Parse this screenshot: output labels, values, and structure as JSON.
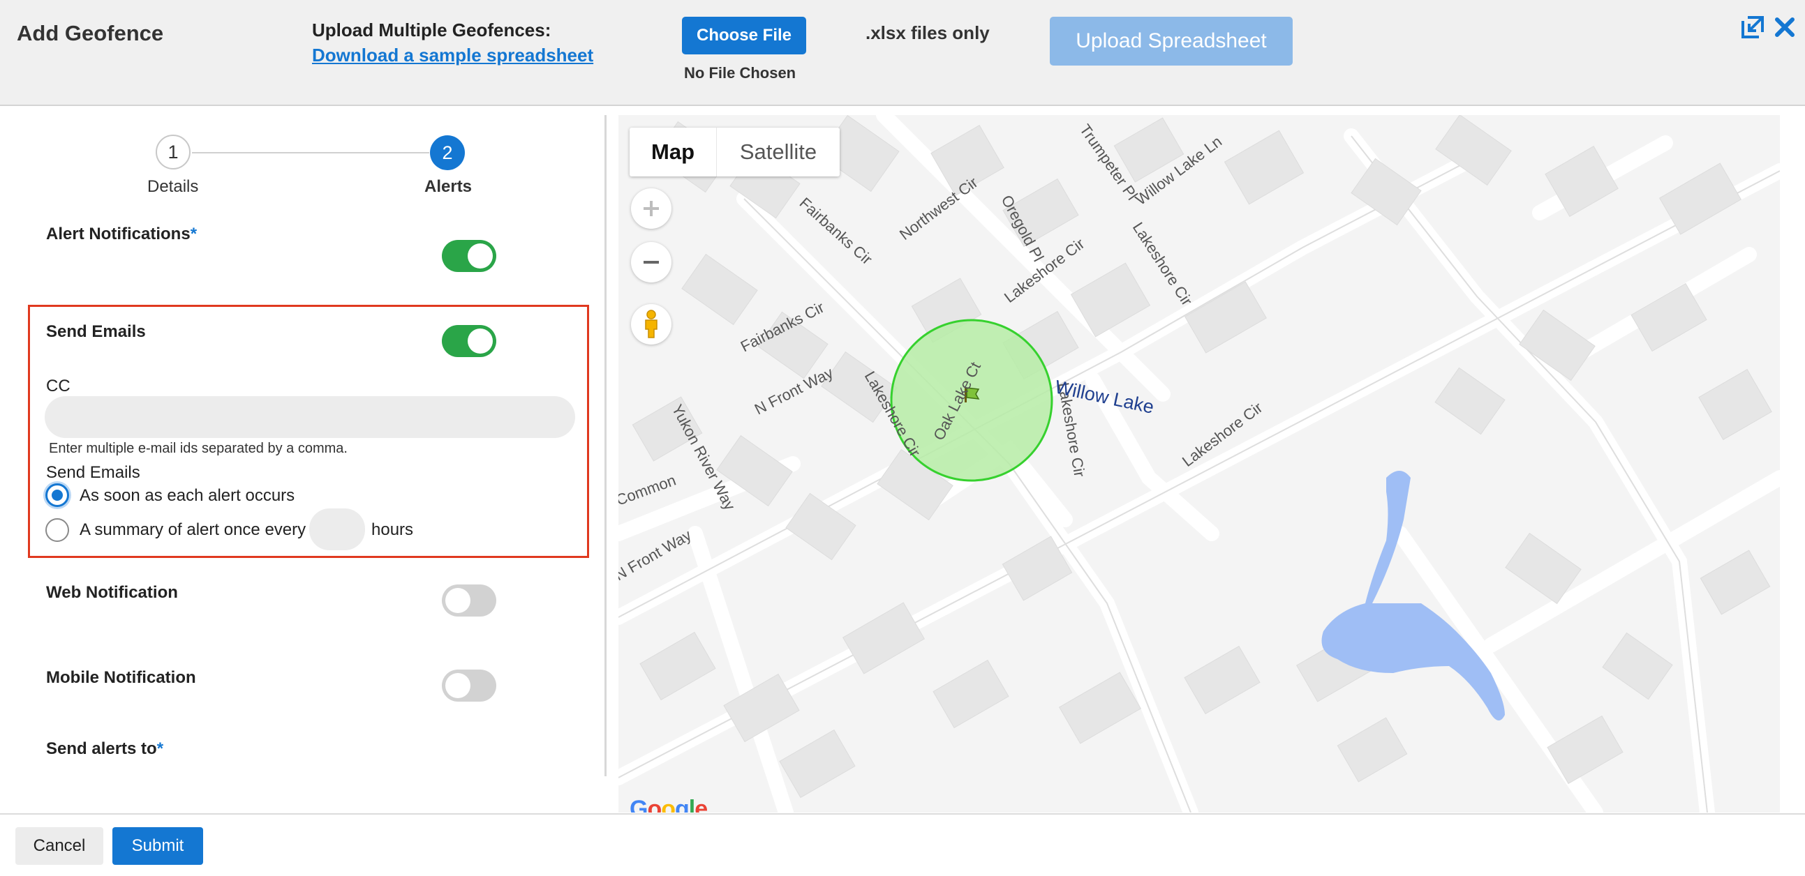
{
  "header": {
    "title": "Add Geofence",
    "upload_label": "Upload Multiple Geofences:",
    "sample_link": "Download a sample spreadsheet",
    "choose_file": "Choose File",
    "file_status": "No File Chosen",
    "file_hint": ".xlsx files only",
    "upload_button": "Upload Spreadsheet",
    "expand_icon": "expand-icon",
    "close_icon": "close-icon"
  },
  "stepper": {
    "steps": [
      {
        "number": "1",
        "label": "Details"
      },
      {
        "number": "2",
        "label": "Alerts"
      }
    ],
    "active_step": 2
  },
  "form": {
    "alert_notifications": {
      "label": "Alert Notifications",
      "required_mark": "*",
      "enabled": true
    },
    "send_emails": {
      "label": "Send Emails",
      "enabled": true,
      "cc_label": "CC",
      "cc_value": "",
      "cc_help": "Enter multiple e-mail ids separated by a comma.",
      "frequency_label": "Send Emails",
      "options": [
        {
          "label": "As soon as each alert occurs",
          "selected": true
        },
        {
          "label": "A summary of alert once every",
          "selected": false,
          "suffix": "hours",
          "value": ""
        }
      ]
    },
    "web_notification": {
      "label": "Web Notification",
      "enabled": false
    },
    "mobile_notification": {
      "label": "Mobile Notification",
      "enabled": false
    },
    "send_alerts_to": {
      "label": "Send alerts to",
      "required_mark": "*"
    }
  },
  "map": {
    "type_buttons": {
      "map": "Map",
      "satellite": "Satellite"
    },
    "selected_type": "Map",
    "zoom_in_icon": "plus-icon",
    "zoom_out_icon": "minus-icon",
    "pegman_icon": "pegman-icon",
    "logo": "Google",
    "marker_icon": "flag-icon",
    "street_labels": {
      "fairbanks_cir_1": "Fairbanks Cir",
      "fairbanks_cir_2": "Fairbanks Cir",
      "northwest_cir": "Northwest Cir",
      "oregold_pl": "Oregold Pl",
      "trumpeter_pl": "Trumpeter Pl",
      "willow_lake_ln": "Willow Lake Ln",
      "lakeshore_cir_1": "Lakeshore Cir",
      "lakeshore_cir_2": "Lakeshore Cir",
      "lakeshore_cir_3": "Lakeshore Cir",
      "lakeshore_cir_4": "Lakeshore Cir",
      "lakeshore_cir_5": "Lakeshore Cir",
      "n_front_way": "N Front Way",
      "yukon_river_way": "Yukon River Way",
      "oak_lake_ct": "Oak Lake Ct",
      "willow_lake": "Willow Lake",
      "common": "Common",
      "front_way": "N Front Way"
    },
    "colors": {
      "geofence_fill": "#b6eca6",
      "geofence_stroke": "#36d12e",
      "water": "#9fbef5"
    }
  },
  "footer": {
    "cancel": "Cancel",
    "submit": "Submit"
  },
  "colors": {
    "primary": "#1477d2",
    "toggle_on": "#2aa548",
    "highlight_border": "#e0391f"
  }
}
